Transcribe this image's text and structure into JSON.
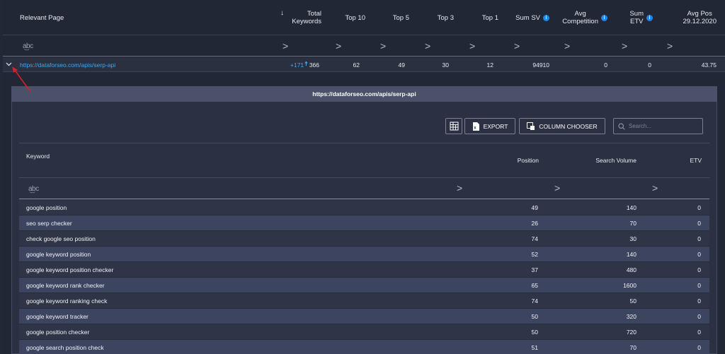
{
  "outer_table": {
    "headers": {
      "relevant_page": "Relevant Page",
      "sort_indicator": "↓",
      "total_keywords_1": "Total",
      "total_keywords_2": "Keywords",
      "top10": "Top 10",
      "top5": "Top 5",
      "top3": "Top 3",
      "top1": "Top 1",
      "sum_sv": "Sum SV",
      "avg_competition_1": "Avg",
      "avg_competition_2": "Competition",
      "sum_etv_1": "Sum",
      "sum_etv_2": "ETV",
      "avg_pos_1": "Avg Pos",
      "avg_pos_2": "29.12.2020"
    },
    "filter": {
      "text_glyph": "a͜bc",
      "operator": ">"
    },
    "row": {
      "url": "https://dataforseo.com/apis/serp-api",
      "delta": "+171",
      "total_keywords": "366",
      "top10": "62",
      "top5": "49",
      "top3": "30",
      "top1": "12",
      "sum_sv": "94910",
      "avg_competition": "0",
      "sum_etv": "0",
      "avg_pos": "43.75"
    }
  },
  "detail": {
    "title": "https://dataforseo.com/apis/serp-api",
    "toolbar": {
      "export_label": "EXPORT",
      "column_chooser_label": "COLUMN CHOOSER",
      "search_placeholder": "Search..."
    },
    "headers": {
      "keyword": "Keyword",
      "position": "Position",
      "search_volume": "Search Volume",
      "etv": "ETV"
    },
    "filter": {
      "text_glyph": "a͜bc",
      "operator": ">"
    },
    "rows": [
      {
        "keyword": "google position",
        "position": "49",
        "search_volume": "140",
        "etv": "0"
      },
      {
        "keyword": "seo serp checker",
        "position": "26",
        "search_volume": "70",
        "etv": "0"
      },
      {
        "keyword": "check google seo position",
        "position": "74",
        "search_volume": "30",
        "etv": "0"
      },
      {
        "keyword": "google keyword position",
        "position": "52",
        "search_volume": "140",
        "etv": "0"
      },
      {
        "keyword": "google keyword position checker",
        "position": "37",
        "search_volume": "480",
        "etv": "0"
      },
      {
        "keyword": "google keyword rank checker",
        "position": "65",
        "search_volume": "1600",
        "etv": "0"
      },
      {
        "keyword": "google keyword ranking check",
        "position": "74",
        "search_volume": "50",
        "etv": "0"
      },
      {
        "keyword": "google keyword tracker",
        "position": "50",
        "search_volume": "320",
        "etv": "0"
      },
      {
        "keyword": "google position checker",
        "position": "50",
        "search_volume": "720",
        "etv": "0"
      },
      {
        "keyword": "google search position check",
        "position": "51",
        "search_volume": "70",
        "etv": "0"
      }
    ]
  },
  "colors": {
    "link": "#3fa9f5",
    "info_icon": "#1e88e5",
    "annotation_arrow": "#d4202a",
    "panel_title_bg": "#4a5169",
    "row_alt_bg": "#3d4460"
  },
  "icons": {
    "info": "info-icon",
    "expand": "chevron-down-icon",
    "grid": "grid-icon",
    "export": "excel-export-icon",
    "column_chooser": "column-chooser-icon",
    "search": "search-icon",
    "annotation": "red-arrow-annotation"
  }
}
